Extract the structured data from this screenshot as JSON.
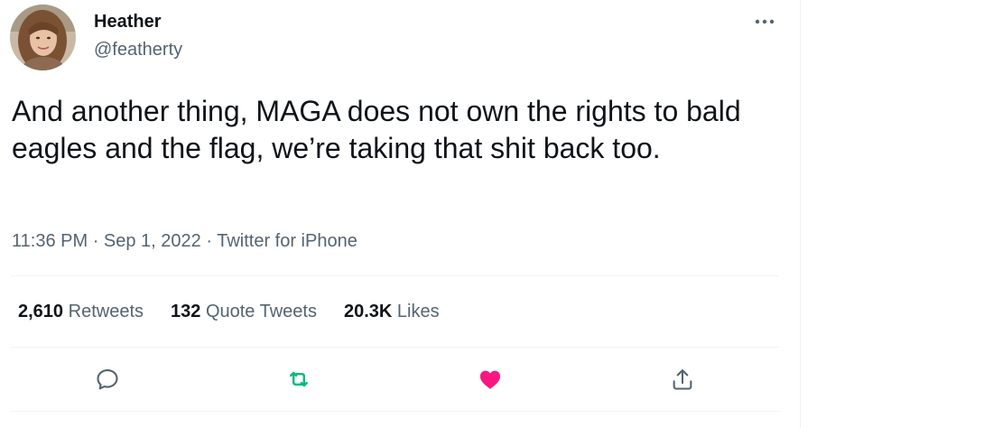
{
  "author": {
    "display_name": "Heather",
    "handle": "@featherty"
  },
  "tweet": {
    "text": "And another thing, MAGA does not own the rights to bald eagles and the flag, we’re taking that shit back too.",
    "time": "11:36 PM",
    "separator": "·",
    "date": "Sep 1, 2022",
    "source": "Twitter for iPhone"
  },
  "stats": {
    "retweets_count": "2,610",
    "retweets_label": "Retweets",
    "quotes_count": "132",
    "quotes_label": "Quote Tweets",
    "likes_count": "20.3K",
    "likes_label": "Likes"
  },
  "actions": {
    "reply_icon": "reply-icon",
    "retweet_icon": "retweet-icon",
    "like_icon": "heart-icon",
    "share_icon": "share-icon"
  },
  "colors": {
    "text_primary": "#0f1419",
    "text_secondary": "#536471",
    "retweet_active": "#00ba7c",
    "like_active": "#f91880",
    "divider": "#eff3f4"
  }
}
